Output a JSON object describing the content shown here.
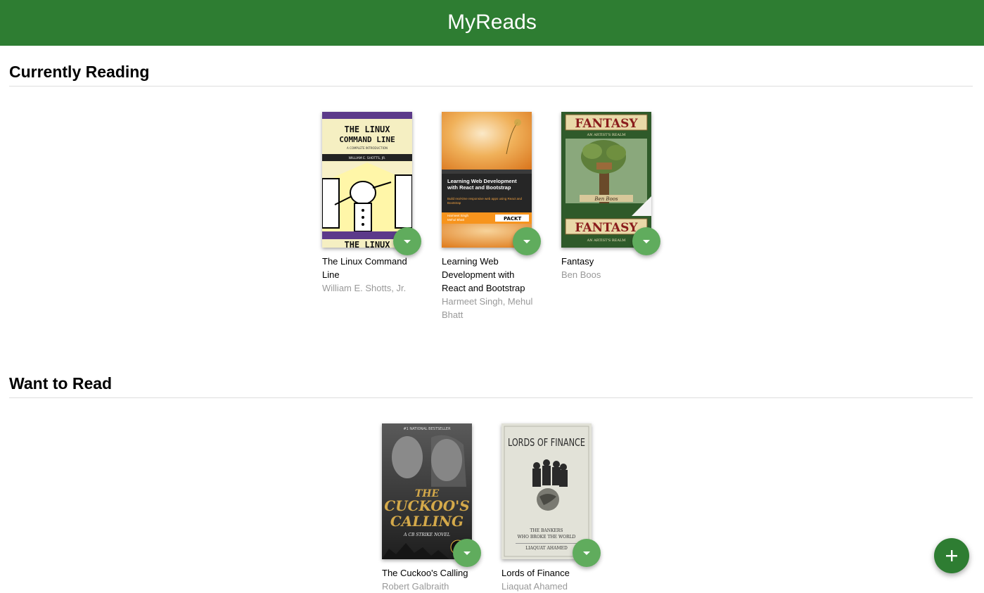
{
  "app": {
    "title": "MyReads"
  },
  "shelves": [
    {
      "title": "Currently Reading",
      "books": [
        {
          "title": "The Linux Command Line",
          "authors": "William E. Shotts, Jr.",
          "cover": {
            "line1": "THE LINUX",
            "line2": "COMMAND LINE",
            "subtitle": "A COMPLETE INTRODUCTION",
            "byline": "WILLIAM E. SHOTTS, JR.",
            "bottom": "THE LINUX"
          }
        },
        {
          "title": "Learning Web Development with React and Bootstrap",
          "authors": "Harmeet Singh, Mehul Bhatt",
          "cover": {
            "heading": "Learning Web Development with React and Bootstrap",
            "tagline": "Build real-time responsive web apps using React and Bootstrap",
            "names": "Harmeet Singh\nMehul Bhatt",
            "publisher": "PACKT"
          }
        },
        {
          "title": "Fantasy",
          "authors": "Ben Boos",
          "cover": {
            "heading": "FANTASY",
            "sub": "AN ARTIST'S REALM",
            "author": "Ben Boos",
            "heading2": "FANTASY",
            "sub2": "AN ARTIST'S REALM"
          }
        }
      ]
    },
    {
      "title": "Want to Read",
      "books": [
        {
          "title": "The Cuckoo's Calling",
          "authors": "Robert Galbraith",
          "cover": {
            "top": "#1 NATIONAL BESTSELLER",
            "line1": "THE",
            "line2": "CUCKOO'S",
            "line3": "CALLING",
            "series": "A CB STRIKE NOVEL"
          }
        },
        {
          "title": "Lords of Finance",
          "authors": "Liaquat Ahamed",
          "cover": {
            "heading": "LORDS OF FINANCE",
            "sub1": "THE BANKERS",
            "sub2": "WHO BROKE THE WORLD",
            "author": "LIAQUAT AHAMED"
          }
        }
      ]
    }
  ],
  "colors": {
    "header": "#2e7d32",
    "changer": "#60ac5d",
    "authors": "#999999"
  },
  "icons": {
    "shelf_changer": "caret-down-icon",
    "add_search": "plus-icon"
  }
}
